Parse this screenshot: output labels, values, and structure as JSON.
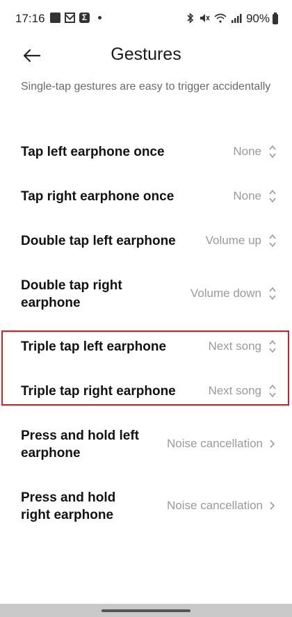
{
  "status_bar": {
    "time": "17:16",
    "battery": "90%",
    "left_icons": [
      "image-icon",
      "gmail-icon",
      "sigma-icon",
      "dot-icon"
    ],
    "right_icons": [
      "bluetooth-icon",
      "mute-icon",
      "wifi-icon",
      "signal-icon",
      "battery-icon"
    ]
  },
  "header": {
    "title": "Gestures",
    "back_icon": "back-arrow-icon"
  },
  "subtitle": "Single-tap gestures are easy to trigger accidentally",
  "gestures": [
    {
      "label": "Tap left earphone once",
      "value": "None",
      "control": "updown"
    },
    {
      "label": "Tap right earphone once",
      "value": "None",
      "control": "updown"
    },
    {
      "label": "Double tap left earphone",
      "value": "Volume up",
      "control": "updown"
    },
    {
      "label_line1": "Double tap right",
      "label_line2": "earphone",
      "value": "Volume down",
      "control": "updown"
    },
    {
      "label": "Triple tap left earphone",
      "value": "Next song",
      "control": "updown"
    },
    {
      "label": "Triple tap right earphone",
      "value": "Next song",
      "control": "updown"
    },
    {
      "label_line1": "Press and hold left",
      "label_line2": "earphone",
      "value": "Noise cancellation",
      "control": "chevron"
    },
    {
      "label_line1": "Press and hold",
      "label_line2": "right earphone",
      "value": "Noise cancellation",
      "control": "chevron"
    }
  ],
  "colors": {
    "highlight": "#d01e2a",
    "value_text": "#9a9a9a",
    "subtitle_text": "#6a6a6a"
  }
}
